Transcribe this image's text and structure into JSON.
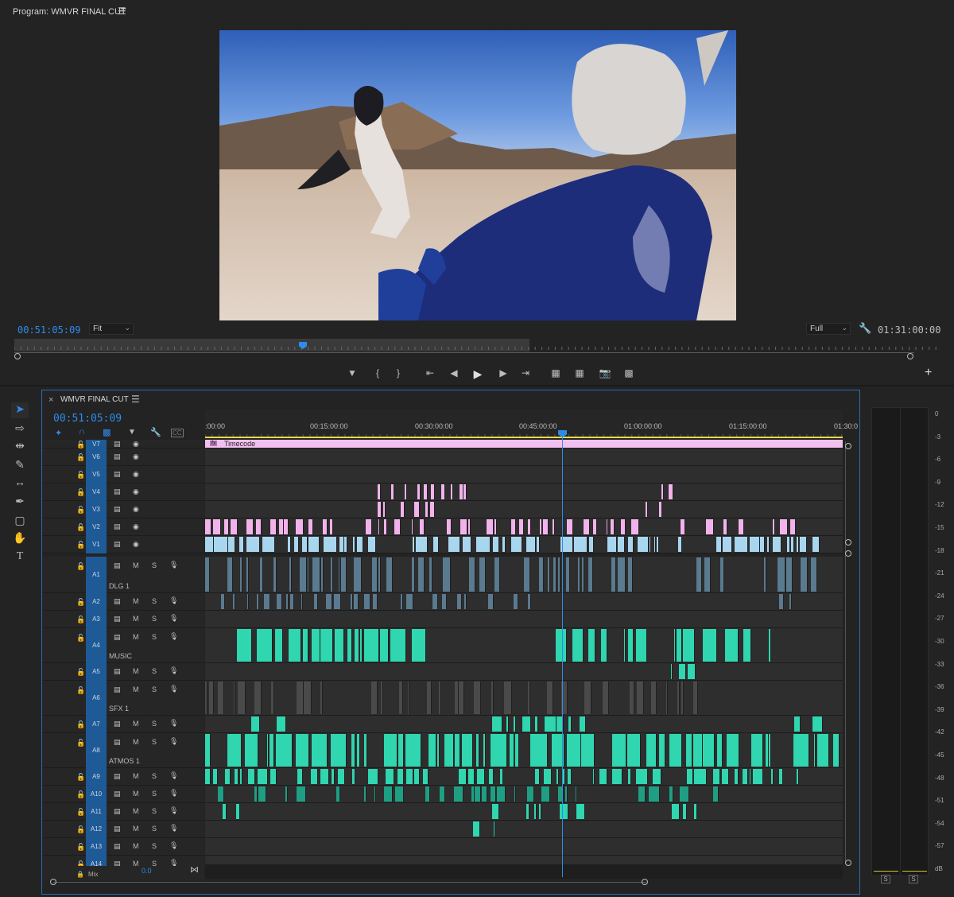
{
  "program": {
    "title": "Program: WMVR FINAL CUT",
    "menu_icon": "hamburger-menu-icon",
    "current_timecode": "00:51:05:09",
    "zoom_value": "Fit",
    "resolution_value": "Full",
    "duration_timecode": "01:31:00:00",
    "playhead_fraction": 0.56,
    "controls": [
      "marker-icon",
      "mark-in-icon",
      "mark-out-icon",
      "go-to-in-icon",
      "step-back-icon",
      "play-icon",
      "step-forward-icon",
      "go-to-out-icon",
      "lift-icon",
      "extract-icon",
      "export-frame-icon",
      "comparison-view-icon"
    ],
    "add_button": "+"
  },
  "timeline": {
    "tab_close": "×",
    "title": "WMVR FINAL CUT",
    "menu_icon": "hamburger-menu-icon",
    "current_timecode": "00:51:05:09",
    "ruler_labels": [
      ":00:00",
      "00:15:00:00",
      "00:30:00:00",
      "00:45:00:00",
      "01:00:00:00",
      "01:15:00:00",
      "01:30:0"
    ],
    "timecode_clip_label": "Timecode",
    "fx_badge": "fx",
    "video_tracks": [
      "V7",
      "V6",
      "V5",
      "V4",
      "V3",
      "V2",
      "V1"
    ],
    "audio_tracks": [
      {
        "id": "A1",
        "name": "DLG 1"
      },
      {
        "id": "A2",
        "name": ""
      },
      {
        "id": "A3",
        "name": ""
      },
      {
        "id": "A4",
        "name": "MUSIC"
      },
      {
        "id": "A5",
        "name": ""
      },
      {
        "id": "A6",
        "name": "SFX 1"
      },
      {
        "id": "A7",
        "name": ""
      },
      {
        "id": "A8",
        "name": "ATMOS 1"
      },
      {
        "id": "A9",
        "name": ""
      },
      {
        "id": "A10",
        "name": ""
      },
      {
        "id": "A11",
        "name": ""
      },
      {
        "id": "A12",
        "name": ""
      },
      {
        "id": "A13",
        "name": ""
      },
      {
        "id": "A14",
        "name": ""
      }
    ],
    "mute_label": "M",
    "solo_label": "S",
    "mix_label": "Mix",
    "mix_value": "0.0",
    "playhead_fraction": 0.56
  },
  "meter": {
    "db_labels": [
      "0",
      "-3",
      "-6",
      "-9",
      "-12",
      "-15",
      "-18",
      "-21",
      "-24",
      "-27",
      "-30",
      "-33",
      "-36",
      "-39",
      "-42",
      "-45",
      "-48",
      "-51",
      "-54",
      "-57",
      "dB"
    ],
    "solo_buttons": [
      "S",
      "S"
    ]
  },
  "colors": {
    "accent_blue": "#2d8ceb",
    "track_blue": "#1e5a96",
    "clip_pink": "#f2b3ec",
    "clip_lightblue": "#a9d6ef",
    "clip_teal": "#2fd6b0"
  }
}
